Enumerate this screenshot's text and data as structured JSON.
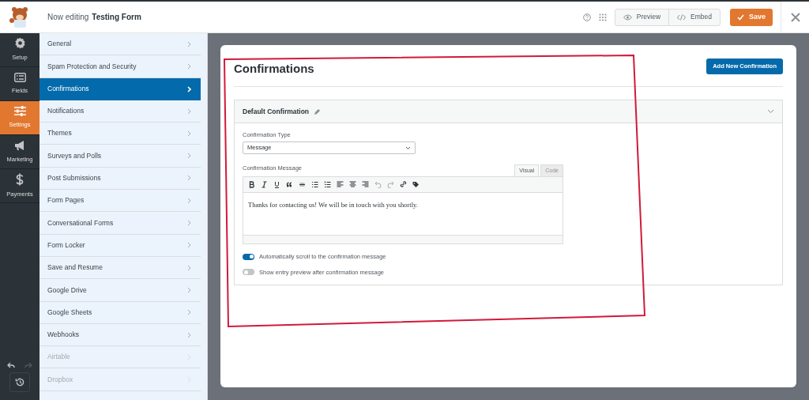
{
  "header": {
    "prefix": "Now editing",
    "form_name": "Testing Form",
    "buttons": [
      {
        "kind": "preview",
        "label": "Preview"
      },
      {
        "kind": "embed",
        "label": "Embed"
      }
    ],
    "save": "Save"
  },
  "rail": [
    {
      "label": "Setup",
      "selected": false
    },
    {
      "label": "Fields",
      "selected": false
    },
    {
      "label": "Settings",
      "selected": true
    },
    {
      "label": "Marketing",
      "selected": false
    },
    {
      "label": "Payments",
      "selected": false
    }
  ],
  "settings_nav": [
    {
      "label": "General",
      "selected": false,
      "disabled": false
    },
    {
      "label": "Spam Protection and Security",
      "selected": false,
      "disabled": false
    },
    {
      "label": "Confirmations",
      "selected": true,
      "disabled": false
    },
    {
      "label": "Notifications",
      "selected": false,
      "disabled": false
    },
    {
      "label": "Themes",
      "selected": false,
      "disabled": false
    },
    {
      "label": "Surveys and Polls",
      "selected": false,
      "disabled": false
    },
    {
      "label": "Post Submissions",
      "selected": false,
      "disabled": false
    },
    {
      "label": "Form Pages",
      "selected": false,
      "disabled": false
    },
    {
      "label": "Conversational Forms",
      "selected": false,
      "disabled": false
    },
    {
      "label": "Form Locker",
      "selected": false,
      "disabled": false
    },
    {
      "label": "Save and Resume",
      "selected": false,
      "disabled": false
    },
    {
      "label": "Google Drive",
      "selected": false,
      "disabled": false
    },
    {
      "label": "Google Sheets",
      "selected": false,
      "disabled": false
    },
    {
      "label": "Webhooks",
      "selected": false,
      "disabled": false
    },
    {
      "label": "Airtable",
      "selected": false,
      "disabled": true
    },
    {
      "label": "Dropbox",
      "selected": false,
      "disabled": true
    }
  ],
  "main": {
    "title": "Confirmations",
    "add_button": "Add New Confirmation",
    "panel": {
      "title": "Default Confirmation",
      "type_label": "Confirmation Type",
      "type_value": "Message",
      "message_label": "Confirmation Message",
      "editor_tabs": [
        {
          "label": "Visual",
          "selected": true
        },
        {
          "label": "Code",
          "selected": false
        }
      ],
      "message": "Thanks for contacting us! We will be in touch with you shortly.",
      "toggles": [
        {
          "label": "Automatically scroll to the confirmation message",
          "on": true
        },
        {
          "label": "Show entry preview after confirmation message",
          "on": false
        }
      ]
    }
  }
}
